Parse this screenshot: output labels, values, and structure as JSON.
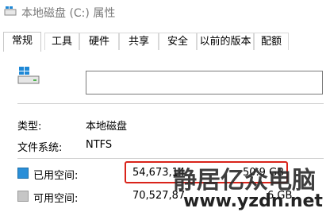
{
  "window": {
    "title": "本地磁盘 (C:) 属性"
  },
  "tabs": [
    {
      "label": "常规",
      "active": true
    },
    {
      "label": "工具"
    },
    {
      "label": "硬件"
    },
    {
      "label": "共享"
    },
    {
      "label": "安全"
    },
    {
      "label": "以前的版本"
    },
    {
      "label": "配额"
    }
  ],
  "general": {
    "drive_name_value": "",
    "type_label": "类型:",
    "type_value": "本地磁盘",
    "fs_label": "文件系统:",
    "fs_value": "NTFS",
    "used_label": "已用空间:",
    "used_bytes": "54,673,14",
    "used_bytes_tail": "字节",
    "used_gb": "50.9 GB",
    "free_label": "可用空间:",
    "free_bytes": "70,527,87",
    "free_gb": "6 GB"
  },
  "watermark": {
    "text": "静居亿众电脑",
    "url": "www.yzdn.net"
  },
  "colors": {
    "used": "#2a8fd8",
    "free": "#c6c6c6",
    "highlight": "#d9231a"
  }
}
